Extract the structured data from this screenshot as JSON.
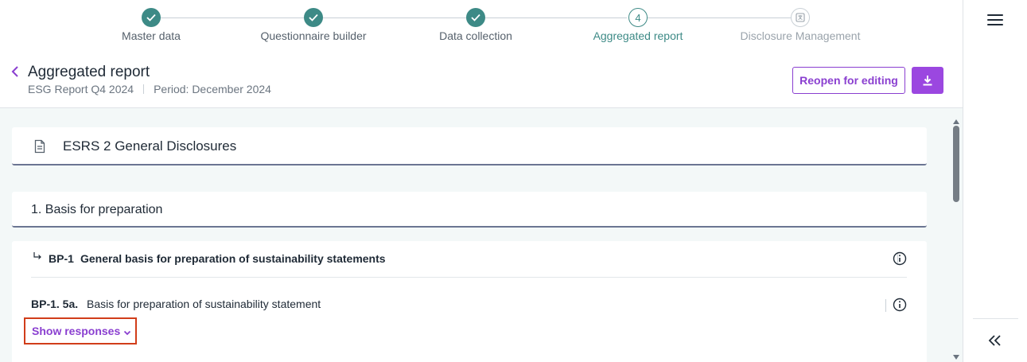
{
  "stepper": {
    "steps": [
      {
        "label": "Master data",
        "state": "done"
      },
      {
        "label": "Questionnaire builder",
        "state": "done"
      },
      {
        "label": "Data collection",
        "state": "done"
      },
      {
        "label": "Aggregated report",
        "state": "current",
        "number": "4"
      },
      {
        "label": "Disclosure Management",
        "state": "future"
      }
    ]
  },
  "header": {
    "title": "Aggregated report",
    "report_name": "ESG Report Q4 2024",
    "period": "Period: December 2024",
    "reopen_label": "Reopen for editing"
  },
  "content": {
    "section_title": "ESRS 2 General Disclosures",
    "subsection_title": "1. Basis for preparation",
    "disclosure": {
      "code": "BP-1",
      "title": "General basis for preparation of sustainability statements"
    },
    "question": {
      "code": "BP-1. 5a.",
      "title": "Basis for preparation of sustainability statement"
    },
    "show_responses_label": "Show responses"
  },
  "colors": {
    "accent": "#8a3fd0",
    "teal": "#3d8a86",
    "highlight_border": "#d13d1a"
  }
}
